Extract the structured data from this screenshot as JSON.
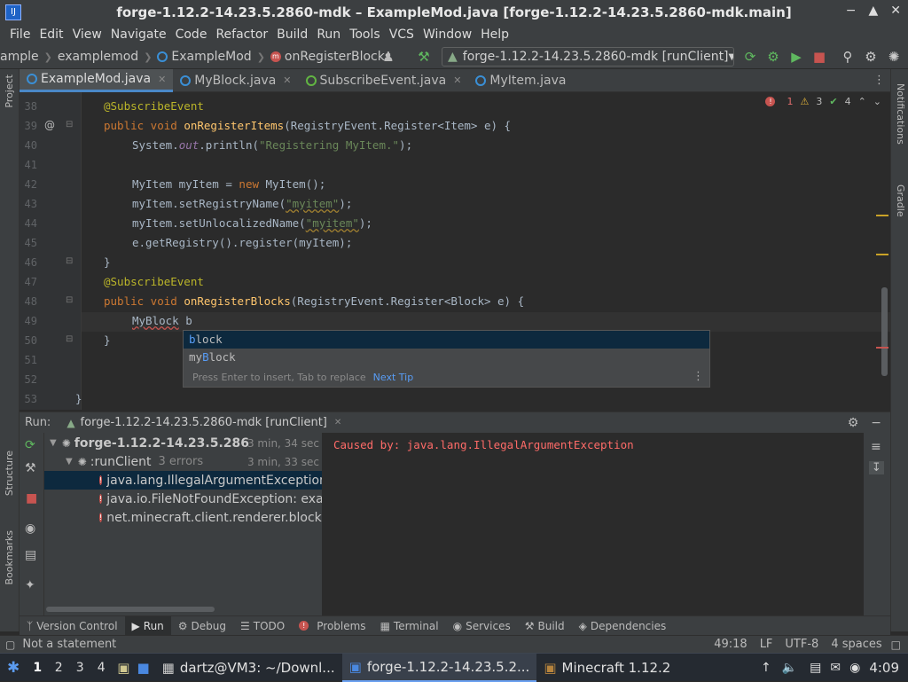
{
  "window": {
    "title": "forge-1.12.2-14.23.5.2860-mdk – ExampleMod.java [forge-1.12.2-14.23.5.2860-mdk.main]"
  },
  "menu": [
    "File",
    "Edit",
    "View",
    "Navigate",
    "Code",
    "Refactor",
    "Build",
    "Run",
    "Tools",
    "VCS",
    "Window",
    "Help"
  ],
  "breadcrumbs": [
    "ample",
    "examplemod",
    "ExampleMod",
    "onRegisterBlocks"
  ],
  "run_config": "forge-1.12.2-14.23.5.2860-mdk [runClient]",
  "tabs": [
    {
      "label": "ExampleMod.java"
    },
    {
      "label": "MyBlock.java"
    },
    {
      "label": "SubscribeEvent.java"
    },
    {
      "label": "MyItem.java"
    }
  ],
  "side_left": {
    "project": "Project",
    "structure": "Structure",
    "bookmarks": "Bookmarks"
  },
  "side_right": {
    "notifications": "Notifications",
    "gradle": "Gradle"
  },
  "inspections": {
    "errors": "1",
    "warnings": "3",
    "weak": "4"
  },
  "editor": {
    "line_numbers": [
      "38",
      "39",
      "40",
      "41",
      "42",
      "43",
      "44",
      "45",
      "46",
      "47",
      "48",
      "49",
      "50",
      "51",
      "52",
      "53"
    ],
    "lines": {
      "l38": {
        "ann": "@SubscribeEvent"
      },
      "l39": {
        "kw": "public void ",
        "fn": "onRegisterItems",
        "rest": "(RegistryEvent.Register<Item> e) {"
      },
      "l40": {
        "a": "System.",
        "b": "out",
        "c": ".println(",
        "s": "\"Registering MyItem.\"",
        "d": ");"
      },
      "l42": {
        "a": "MyItem myItem = ",
        "kw": "new ",
        "b": "MyItem();"
      },
      "l43": {
        "a": "myItem.setRegistryName(",
        "s": "\"myitem\"",
        "b": ");"
      },
      "l44": {
        "a": "myItem.setUnlocalizedName(",
        "s": "\"myitem\"",
        "b": ");"
      },
      "l45": {
        "a": "e.getRegistry().register(myItem);"
      },
      "l46": {
        "a": "}"
      },
      "l47": {
        "ann": "@SubscribeEvent"
      },
      "l48": {
        "kw": "public void ",
        "fn": "onRegisterBlocks",
        "rest": "(RegistryEvent.Register<Block> e) {"
      },
      "l49": {
        "a": "MyBlock",
        "b": " b"
      },
      "l50": {
        "a": "}"
      },
      "l53": {
        "a": "}"
      }
    }
  },
  "completion": {
    "item1": {
      "hl": "b",
      "rest": "lock"
    },
    "item2": {
      "pre": "my",
      "hl": "B",
      "rest": "lock"
    },
    "footer": "Press Enter to insert, Tab to replace",
    "tip": "Next Tip"
  },
  "run_panel": {
    "label": "Run:",
    "tab": "forge-1.12.2-14.23.5.2860-mdk [runClient]",
    "tree": [
      {
        "label": "forge-1.12.2-14.23.5.286",
        "time": "3 min, 34 sec"
      },
      {
        "label": ":runClient",
        "extra": "3 errors",
        "time": "3 min, 33 sec"
      },
      {
        "label": "java.lang.IllegalArgumentException"
      },
      {
        "label": "java.io.FileNotFoundException: exar"
      },
      {
        "label": "net.minecraft.client.renderer.block.r"
      }
    ],
    "console": "Caused by: java.lang.IllegalArgumentException"
  },
  "bottom_tabs": [
    "Version Control",
    "Run",
    "Debug",
    "TODO",
    "Problems",
    "Terminal",
    "Services",
    "Build",
    "Dependencies"
  ],
  "status": {
    "message": "Not a statement",
    "position": "49:18",
    "line_sep": "LF",
    "encoding": "UTF-8",
    "indent": "4 spaces"
  },
  "taskbar": {
    "workspaces": [
      "1",
      "2",
      "3",
      "4"
    ],
    "tasks": [
      "dartz@VM3: ~/Downl...",
      "forge-1.12.2-14.23.5.2...",
      "Minecraft 1.12.2"
    ],
    "clock": "4:09"
  }
}
